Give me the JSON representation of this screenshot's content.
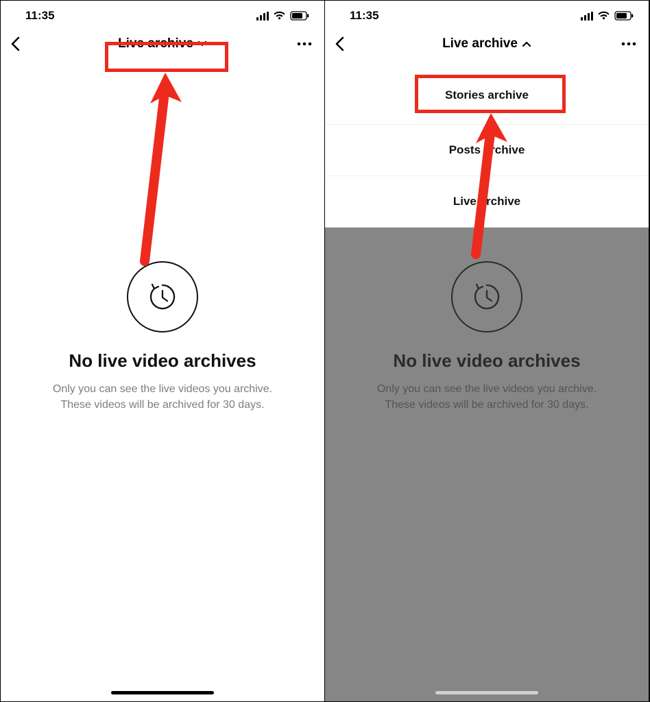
{
  "annotation_color": "#ec2a1e",
  "left": {
    "status": {
      "time": "11:35"
    },
    "nav": {
      "title": "Live archive",
      "chevron": "down"
    },
    "empty_state": {
      "headline": "No live video archives",
      "sub1": "Only you can see the live videos you archive.",
      "sub2": "These videos will be archived for 30 days."
    }
  },
  "right": {
    "status": {
      "time": "11:35"
    },
    "nav": {
      "title": "Live archive",
      "chevron": "up"
    },
    "dropdown": {
      "items": [
        {
          "label": "Stories archive"
        },
        {
          "label": "Posts archive"
        },
        {
          "label": "Live archive"
        }
      ]
    },
    "empty_state": {
      "headline": "No live video archives",
      "sub1": "Only you can see the live videos you archive.",
      "sub2": "These videos will be archived for 30 days."
    }
  }
}
